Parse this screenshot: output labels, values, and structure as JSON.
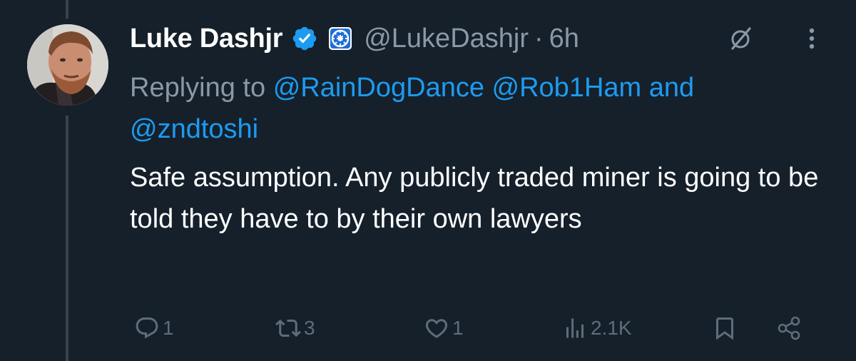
{
  "tweet": {
    "author": {
      "name": "Luke Dashjr",
      "handle": "@LukeDashjr",
      "avatar_icon": "profile-photo"
    },
    "separator": "·",
    "time": "6h",
    "replying_to": {
      "prefix": "Replying to",
      "mentions": [
        "@RainDogDance",
        "@Rob1Ham"
      ],
      "conjunction": "and",
      "last_mention": "@zndtoshi"
    },
    "body": "Safe assumption. Any publicly traded miner is going to be told they have to by their own lawyers",
    "stats": {
      "replies": "1",
      "reposts": "3",
      "likes": "1",
      "views": "2.1K"
    }
  },
  "icons": {
    "verified": "verified-badge-icon",
    "affiliate": "affiliate-badge-icon",
    "grok": "grok-icon",
    "more": "more-options-icon",
    "reply": "reply-icon",
    "repost": "repost-icon",
    "like": "heart-icon",
    "views": "views-icon",
    "bookmark": "bookmark-icon",
    "share": "share-icon"
  },
  "colors": {
    "background": "#15202b",
    "text": "#ffffff",
    "secondary": "#8b98a5",
    "accent": "#1d9bf0",
    "action_icons": "#5f6d7a"
  }
}
